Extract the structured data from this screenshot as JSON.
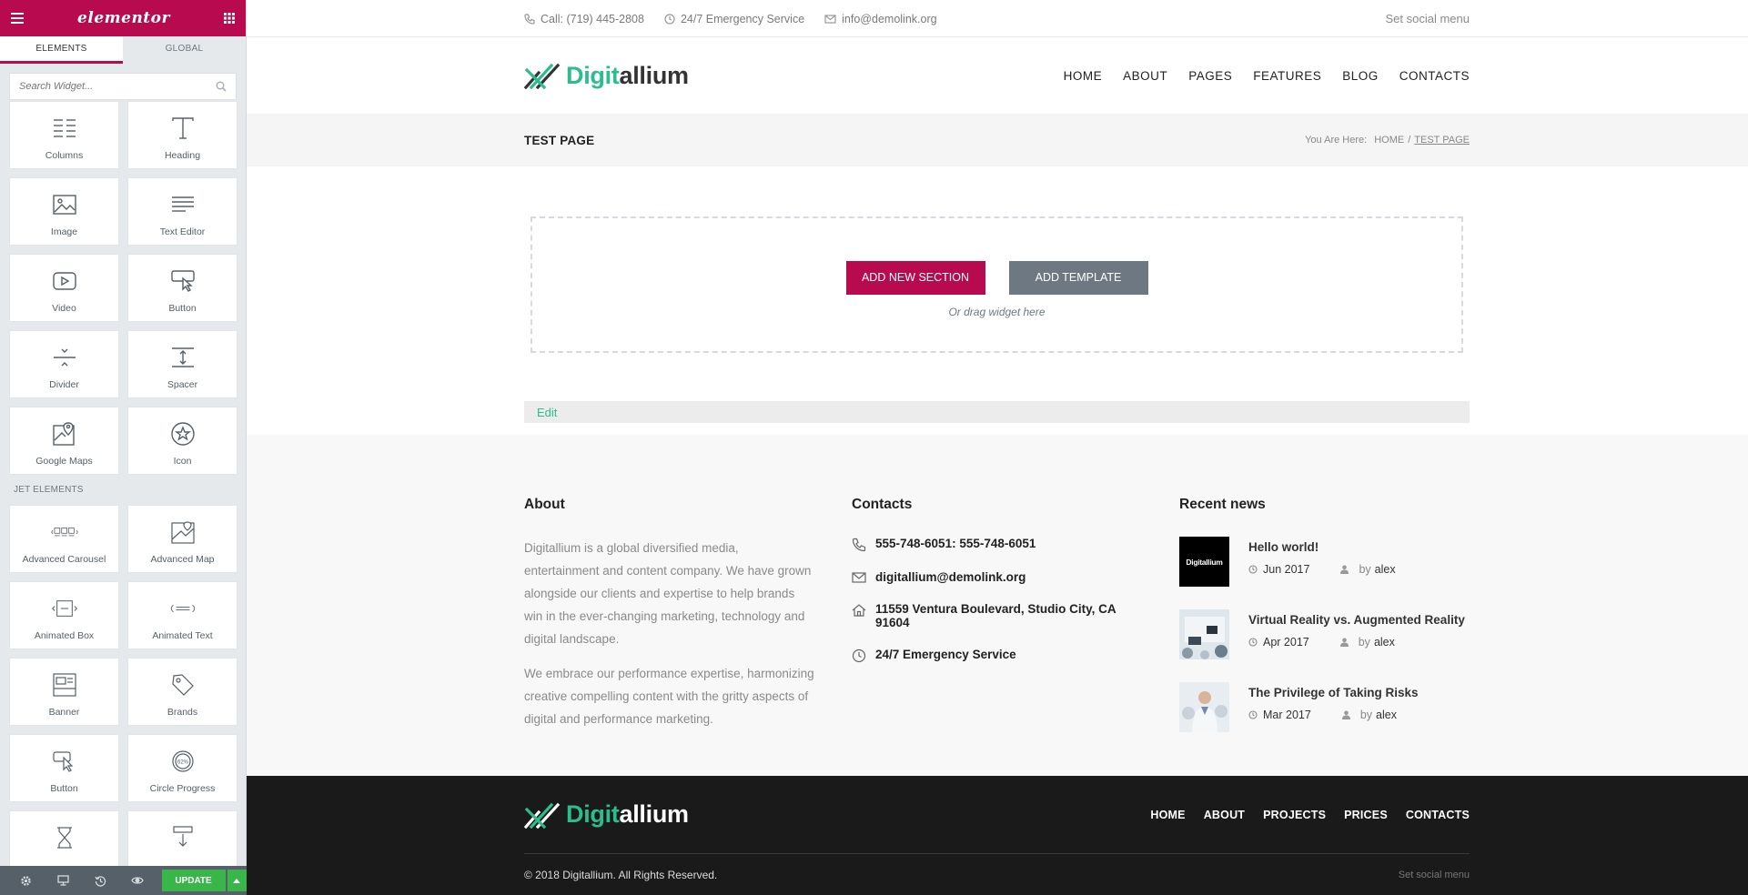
{
  "panel": {
    "logo": "elementor",
    "tabs": [
      "ELEMENTS",
      "GLOBAL"
    ],
    "search_placeholder": "Search Widget...",
    "basic_widgets": [
      {
        "label": "Columns",
        "icon": "columns-icon"
      },
      {
        "label": "Heading",
        "icon": "heading-icon"
      },
      {
        "label": "Image",
        "icon": "image-icon"
      },
      {
        "label": "Text Editor",
        "icon": "text-editor-icon"
      },
      {
        "label": "Video",
        "icon": "video-icon"
      },
      {
        "label": "Button",
        "icon": "button-icon"
      },
      {
        "label": "Divider",
        "icon": "divider-icon"
      },
      {
        "label": "Spacer",
        "icon": "spacer-icon"
      },
      {
        "label": "Google Maps",
        "icon": "google-maps-icon"
      },
      {
        "label": "Icon",
        "icon": "star-icon"
      }
    ],
    "jet_category": "JET ELEMENTS",
    "jet_widgets": [
      {
        "label": "Advanced Carousel",
        "icon": "carousel-icon"
      },
      {
        "label": "Advanced Map",
        "icon": "map-icon"
      },
      {
        "label": "Animated Box",
        "icon": "animated-box-icon"
      },
      {
        "label": "Animated Text",
        "icon": "animated-text-icon"
      },
      {
        "label": "Banner",
        "icon": "banner-icon"
      },
      {
        "label": "Brands",
        "icon": "brands-icon"
      },
      {
        "label": "Button",
        "icon": "jet-button-icon"
      },
      {
        "label": "Circle Progress",
        "icon": "circle-progress-icon"
      },
      {
        "label": "",
        "icon": "hourglass-icon"
      },
      {
        "label": "",
        "icon": "download-icon"
      }
    ],
    "update_label": "UPDATE"
  },
  "topbar": {
    "phone": "Call: (719) 445-2808",
    "service": "24/7 Emergency Service",
    "email": "info@demolink.org",
    "social": "Set social menu"
  },
  "brand": {
    "accent": "Digit",
    "rest": "allium"
  },
  "nav": [
    "HOME",
    "ABOUT",
    "PAGES",
    "FEATURES",
    "BLOG",
    "CONTACTS"
  ],
  "title_bar": {
    "title": "TEST PAGE",
    "you_are_here": "You Are Here:",
    "crumb_home": "HOME",
    "crumb_sep": "/",
    "crumb_current": "TEST PAGE"
  },
  "dropzone": {
    "add_section": "ADD NEW SECTION",
    "add_template": "ADD TEMPLATE",
    "hint": "Or drag widget here"
  },
  "edit_label": "Edit",
  "about": {
    "heading": "About",
    "p1": "Digitallium is a global diversified media, entertainment and content company. We have grown alongside our clients and expertise to help brands win in the ever-changing marketing, technology and digital landscape.",
    "p2": "We embrace our performance expertise, harmonizing creative compelling content with the gritty aspects of digital and performance marketing."
  },
  "contacts": {
    "heading": "Contacts",
    "phone": "555-748-6051: 555-748-6051",
    "email": "digitallium@demolink.org",
    "address": "11559 Ventura Boulevard, Studio City, CA 91604",
    "service": "24/7 Emergency Service"
  },
  "news": {
    "heading": "Recent news",
    "by_label": "by",
    "thumb_label": "Digitallium",
    "items": [
      {
        "title": "Hello world!",
        "date": "Jun 2017",
        "author": "alex"
      },
      {
        "title": "Virtual Reality vs. Augmented Reality",
        "date": "Apr 2017",
        "author": "alex"
      },
      {
        "title": "The Privilege of Taking Risks",
        "date": "Mar 2017",
        "author": "alex"
      }
    ]
  },
  "footer": {
    "nav": [
      "HOME",
      "ABOUT",
      "PROJECTS",
      "PRICES",
      "CONTACTS"
    ],
    "copyright": "© 2018 Digitallium. All Rights Reserved.",
    "social": "Set social menu"
  },
  "colors": {
    "elementor_brand": "#b80b4f",
    "site_accent": "#2bbd8e",
    "update_green": "#39b54a",
    "template_gray": "#6d7882",
    "footer_dark": "#1a1a1a"
  }
}
